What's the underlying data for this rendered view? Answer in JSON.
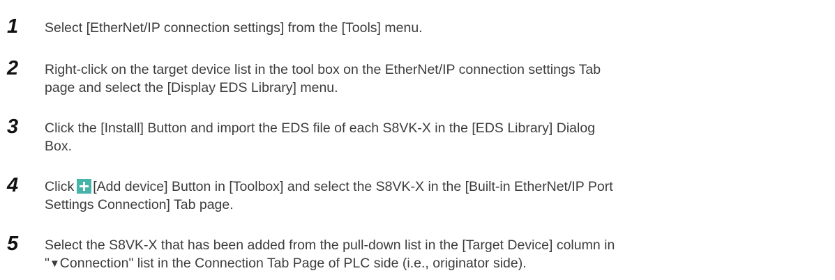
{
  "steps": [
    {
      "number": "1",
      "lines": [
        "Select [EtherNet/IP connection settings] from the [Tools] menu."
      ]
    },
    {
      "number": "2",
      "lines": [
        "Right-click on the target device list in the tool box on the EtherNet/IP connection settings Tab",
        "page and select the [Display EDS Library] menu."
      ]
    },
    {
      "number": "3",
      "lines": [
        "Click the [Install] Button and import the EDS file of each S8VK-X in the [EDS Library] Dialog",
        "Box."
      ]
    },
    {
      "number": "4",
      "line1_before_icon": "Click",
      "line1_after_icon": "[Add device] Button in [Toolbox] and select the S8VK-X in the [Built-in EtherNet/IP Port",
      "line2": "Settings Connection] Tab page.",
      "icon": "add-device-icon"
    },
    {
      "number": "5",
      "line1": "Select the S8VK-X that has been added from the pull-down list in the [Target Device] column in",
      "line2_prefix": "\"",
      "line2_symbol": "▼",
      "line2_rest": "Connection\" list in the Connection Tab Page of PLC side (i.e., originator side)."
    }
  ]
}
